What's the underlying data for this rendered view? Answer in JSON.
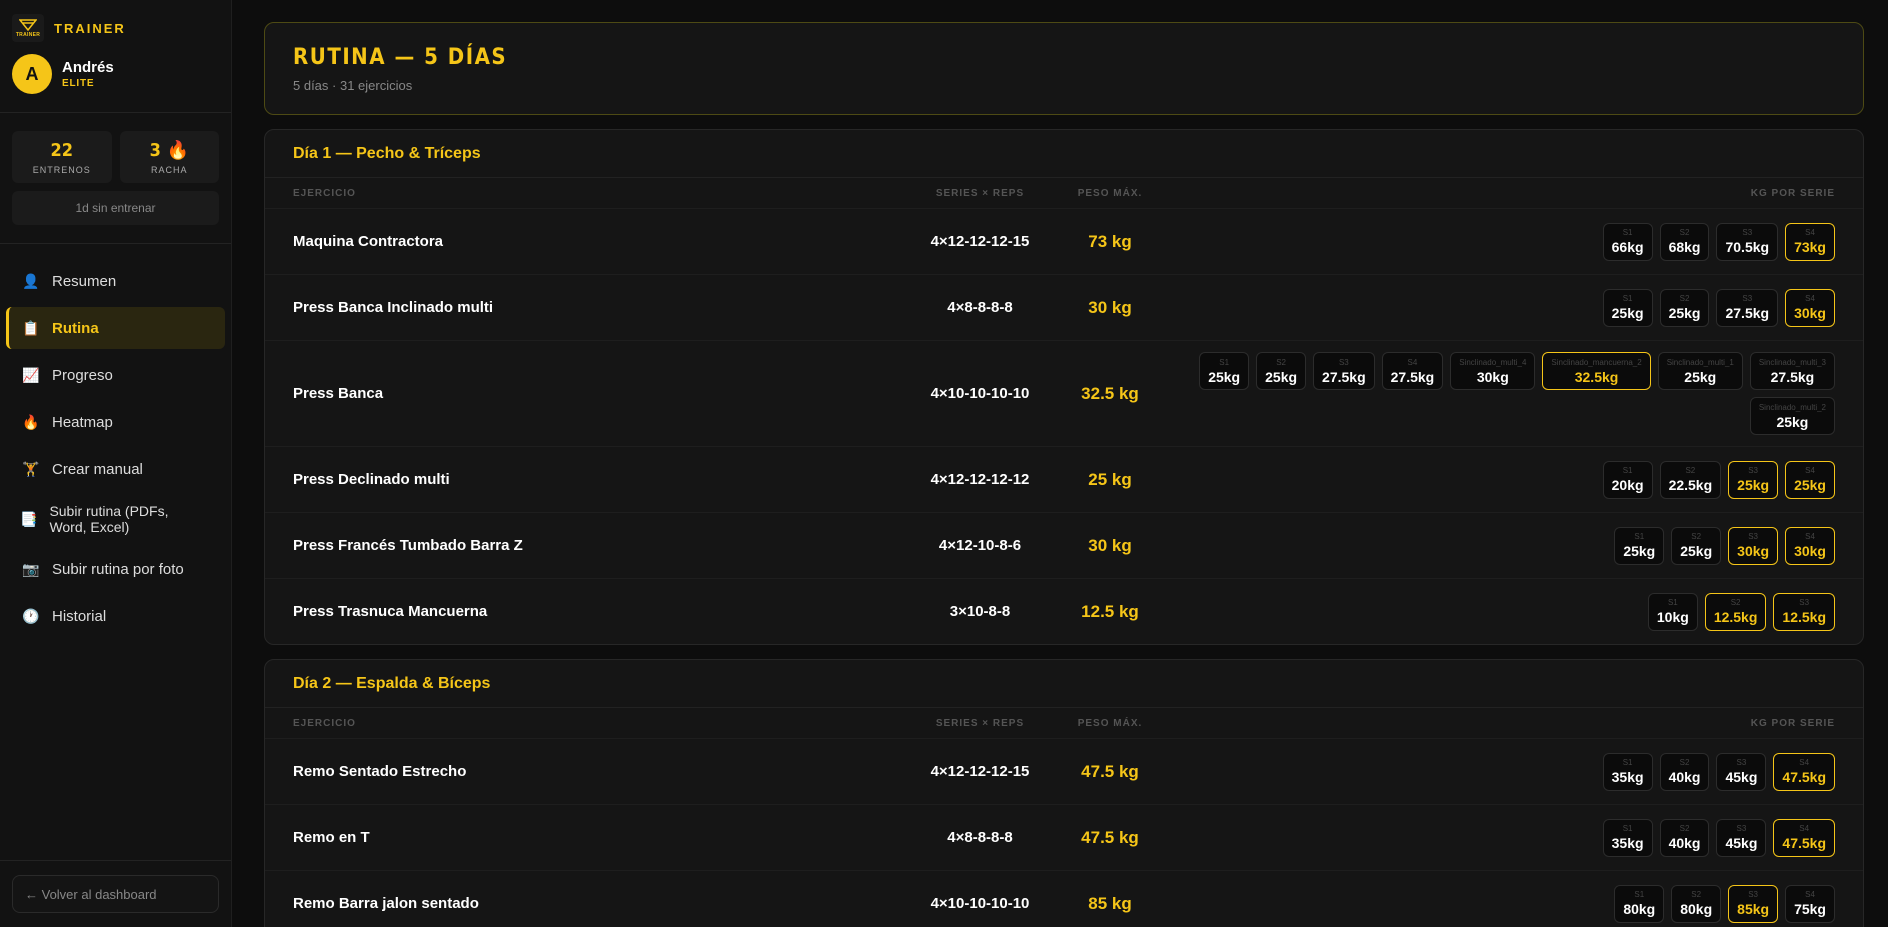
{
  "sidebar": {
    "brand": "TRAINER",
    "logo_text": "TRAINER",
    "user": {
      "initial": "A",
      "name": "Andrés",
      "level": "ELITE"
    },
    "stats": [
      {
        "value": "22",
        "label": "ENTRENOS"
      },
      {
        "value": "3 🔥",
        "label": "RACHA"
      }
    ],
    "since": "1d sin entrenar",
    "nav": [
      {
        "icon": "👤",
        "label": "Resumen",
        "icon_name": "user-icon"
      },
      {
        "icon": "📋",
        "label": "Rutina",
        "icon_name": "clipboard-icon",
        "active": true
      },
      {
        "icon": "📈",
        "label": "Progreso",
        "icon_name": "chart-up-icon"
      },
      {
        "icon": "🔥",
        "label": "Heatmap",
        "icon_name": "fire-icon"
      },
      {
        "icon": "🏋",
        "label": "Crear manual",
        "icon_name": "weightlifter-icon"
      },
      {
        "icon": "📑",
        "label": "Subir rutina (PDFs, Word, Excel)",
        "icon_name": "documents-icon"
      },
      {
        "icon": "📷",
        "label": "Subir rutina por foto",
        "icon_name": "camera-icon"
      },
      {
        "icon": "🕐",
        "label": "Historial",
        "icon_name": "clock-icon"
      }
    ],
    "back": "← Volver al dashboard"
  },
  "header": {
    "title": "RUTINA — 5 DÍAS",
    "subtitle": "5 días · 31 ejercicios"
  },
  "columns": {
    "name": "EJERCICIO",
    "series": "SERIES × REPS",
    "peso": "PESO MÁX.",
    "kg": "KG POR SERIE"
  },
  "colors": {
    "accent": "#f5c518",
    "background": "#0d0d0d",
    "panel": "#151515"
  },
  "days": [
    {
      "title": "Día 1 — Pecho & Tríceps",
      "exercises": [
        {
          "name": "Maquina Contractora",
          "series": "4×12-12-12-15",
          "peso": "73 kg",
          "sets": [
            {
              "l": "S1",
              "v": "66kg"
            },
            {
              "l": "S2",
              "v": "68kg"
            },
            {
              "l": "S3",
              "v": "70.5kg"
            },
            {
              "l": "S4",
              "v": "73kg",
              "max": true
            }
          ]
        },
        {
          "name": "Press Banca Inclinado multi",
          "series": "4×8-8-8-8",
          "peso": "30 kg",
          "sets": [
            {
              "l": "S1",
              "v": "25kg"
            },
            {
              "l": "S2",
              "v": "25kg"
            },
            {
              "l": "S3",
              "v": "27.5kg"
            },
            {
              "l": "S4",
              "v": "30kg",
              "max": true
            }
          ]
        },
        {
          "name": "Press Banca",
          "series": "4×10-10-10-10",
          "peso": "32.5 kg",
          "sets": [
            {
              "l": "S1",
              "v": "25kg"
            },
            {
              "l": "S2",
              "v": "25kg"
            },
            {
              "l": "S3",
              "v": "27.5kg"
            },
            {
              "l": "S4",
              "v": "27.5kg"
            },
            {
              "l": "Sinclinado_multi_4",
              "v": "30kg"
            },
            {
              "l": "Sinclinado_mancuerna_2",
              "v": "32.5kg",
              "max": true
            },
            {
              "l": "Sinclinado_multi_1",
              "v": "25kg"
            },
            {
              "l": "Sinclinado_multi_3",
              "v": "27.5kg"
            },
            {
              "l": "Sinclinado_multi_2",
              "v": "25kg"
            }
          ]
        },
        {
          "name": "Press Declinado multi",
          "series": "4×12-12-12-12",
          "peso": "25 kg",
          "sets": [
            {
              "l": "S1",
              "v": "20kg"
            },
            {
              "l": "S2",
              "v": "22.5kg"
            },
            {
              "l": "S3",
              "v": "25kg",
              "max": true
            },
            {
              "l": "S4",
              "v": "25kg",
              "max": true
            }
          ]
        },
        {
          "name": "Press Francés Tumbado Barra Z",
          "series": "4×12-10-8-6",
          "peso": "30 kg",
          "sets": [
            {
              "l": "S1",
              "v": "25kg"
            },
            {
              "l": "S2",
              "v": "25kg"
            },
            {
              "l": "S3",
              "v": "30kg",
              "max": true
            },
            {
              "l": "S4",
              "v": "30kg",
              "max": true
            }
          ]
        },
        {
          "name": "Press Trasnuca Mancuerna",
          "series": "3×10-8-8",
          "peso": "12.5 kg",
          "sets": [
            {
              "l": "S1",
              "v": "10kg"
            },
            {
              "l": "S2",
              "v": "12.5kg",
              "max": true
            },
            {
              "l": "S3",
              "v": "12.5kg",
              "max": true
            }
          ]
        }
      ]
    },
    {
      "title": "Día 2 — Espalda & Bíceps",
      "exercises": [
        {
          "name": "Remo Sentado Estrecho",
          "series": "4×12-12-12-15",
          "peso": "47.5 kg",
          "sets": [
            {
              "l": "S1",
              "v": "35kg"
            },
            {
              "l": "S2",
              "v": "40kg"
            },
            {
              "l": "S3",
              "v": "45kg"
            },
            {
              "l": "S4",
              "v": "47.5kg",
              "max": true
            }
          ]
        },
        {
          "name": "Remo en T",
          "series": "4×8-8-8-8",
          "peso": "47.5 kg",
          "sets": [
            {
              "l": "S1",
              "v": "35kg"
            },
            {
              "l": "S2",
              "v": "40kg"
            },
            {
              "l": "S3",
              "v": "45kg"
            },
            {
              "l": "S4",
              "v": "47.5kg",
              "max": true
            }
          ]
        },
        {
          "name": "Remo Barra jalon sentado",
          "series": "4×10-10-10-10",
          "peso": "85 kg",
          "sets": [
            {
              "l": "S1",
              "v": "80kg"
            },
            {
              "l": "S2",
              "v": "80kg"
            },
            {
              "l": "S3",
              "v": "85kg",
              "max": true
            },
            {
              "l": "S4",
              "v": "75kg"
            }
          ]
        }
      ]
    }
  ]
}
